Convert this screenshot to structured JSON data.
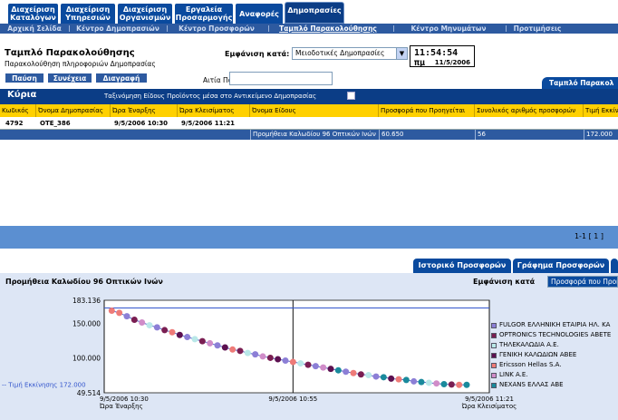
{
  "top_tabs": [
    {
      "label_1": "Διαχείριση",
      "label_2": "Καταλόγων"
    },
    {
      "label_1": "Διαχείριση",
      "label_2": "Υπηρεσιών"
    },
    {
      "label_1": "Διαχείριση",
      "label_2": "Οργανισμών"
    },
    {
      "label_1": "Εργαλεία",
      "label_2": "Προσαρμογής"
    },
    {
      "label_1": "Αναφορές",
      "label_2": ""
    },
    {
      "label_1": "Δημοπρασίες",
      "label_2": ""
    }
  ],
  "sub_tabs": [
    "Αρχική Σελίδα",
    "Κέντρο Δημοπρασιών",
    "Κέντρο Προσφορών",
    "Ταμπλό Παρακολούθησης",
    "Κέντρο Μηνυμάτων",
    "Προτιμήσεις"
  ],
  "header": {
    "title": "Ταμπλό Παρακολούθησης",
    "subtitle": "Παρακολούθηση πληροφοριών Δημοπρασίας",
    "show_label": "Εμφάνιση κατά:",
    "show_value": "Μειοδοτικές Δημοπρασίες",
    "clock_time": "11:54:54 πμ",
    "clock_date": "11/5/2006"
  },
  "buttons": {
    "pause": "Παύση",
    "continue": "Συνέχεια",
    "delete": "Διαγραφή"
  },
  "reason_label": "Αιτία Παύσης",
  "right_tab": "Ταμπλό Παρακολ",
  "main": {
    "title": "Κύρια",
    "group_label": "Ταξινόμηση Είδους Προϊόντος μέσα στο Αντικείμενο Δημοπρασίας"
  },
  "columns": [
    "Κωδικός",
    "Όνομα Δημοπρασίας",
    "Ώρα Έναρξης",
    "Ώρα Κλεισίματος",
    "Όνομα Είδους",
    "Προσφορά που Προηγείται",
    "Συνολικός αριθμός προσφορών",
    "Τιμή Εκκίνη"
  ],
  "row": {
    "code": "4792",
    "name": "OTE_386",
    "start": "9/5/2006 10:30",
    "end": "9/5/2006 11:21"
  },
  "row_item": {
    "item_name": "Προμήθεια Καλωδίου 96 Οπτικών Ινών",
    "leading_bid": "60.650",
    "total_bids": "56",
    "start_price": "172.000"
  },
  "pager": "1-1 [ 1 ]",
  "bottom_tabs": [
    "Ιστορικό Προσφορών",
    "Γράφημα Προσφορών"
  ],
  "chart_panel": {
    "title": "Προμήθεια Καλωδίου 96 Οπτικών Ινών",
    "show_label": "Εμφάνιση κατά",
    "show_value": "Προσφορά που Προηγείται"
  },
  "chart_data": {
    "type": "scatter",
    "y_ticks": [
      "183.136",
      "150.000",
      "100.000",
      "49.514"
    ],
    "ylim": [
      49.514,
      183.136
    ],
    "x_ticks": [
      {
        "time": "9/5/2006 10:30",
        "label": "Ώρα Έναρξης"
      },
      {
        "time": "9/5/2006 10:55",
        "label": ""
      },
      {
        "time": "9/5/2006 11:21",
        "label": "Ώρα Κλεισίματος"
      }
    ],
    "xlim_minutes": [
      0,
      51
    ],
    "reference_line": {
      "label": "-- Τιμή Εκκίνησης 172.000",
      "value": 172.0
    },
    "legend": [
      {
        "name": "FULGOR ΕΛΛΗΝΙΚΗ ΕΤΑΙΡΙΑ ΗΛ. ΚΑ",
        "color": "#8c7fd6"
      },
      {
        "name": "OPTRONICS TECHNOLOGIES ABETE",
        "color": "#7a1e52"
      },
      {
        "name": "ΤΗΛΕΚΑΛΩΔΙΑ Α.Ε.",
        "color": "#b9e8e8"
      },
      {
        "name": "ΓΕΝΙΚΗ ΚΑΛΩΔΙΩΝ ΑΒΕΕ",
        "color": "#5c1050"
      },
      {
        "name": "Ericsson Hellas S.A.",
        "color": "#ee7b78"
      },
      {
        "name": "LINK A.E.",
        "color": "#d08cc8"
      },
      {
        "name": "NEXANS ΕΛΛΑΣ ΑΒΕ",
        "color": "#1a8a9c"
      }
    ],
    "points": [
      [
        1,
        168,
        4
      ],
      [
        2,
        165,
        4
      ],
      [
        3,
        160,
        0
      ],
      [
        4,
        155,
        1
      ],
      [
        5,
        151,
        5
      ],
      [
        6,
        147,
        2
      ],
      [
        7,
        144,
        0
      ],
      [
        8,
        140,
        1
      ],
      [
        9,
        137,
        4
      ],
      [
        10,
        133,
        3
      ],
      [
        11,
        130,
        0
      ],
      [
        12,
        127,
        2
      ],
      [
        13,
        124,
        1
      ],
      [
        14,
        121,
        5
      ],
      [
        15,
        118,
        0
      ],
      [
        16,
        115,
        3
      ],
      [
        17,
        112,
        4
      ],
      [
        18,
        110,
        1
      ],
      [
        19,
        107,
        2
      ],
      [
        20,
        105,
        0
      ],
      [
        21,
        102,
        5
      ],
      [
        22,
        100,
        1
      ],
      [
        23,
        98,
        3
      ],
      [
        24,
        96,
        0
      ],
      [
        25,
        94,
        4
      ],
      [
        26,
        92,
        2
      ],
      [
        27,
        90,
        1
      ],
      [
        28,
        88,
        0
      ],
      [
        29,
        86,
        5
      ],
      [
        30,
        84,
        3
      ],
      [
        31,
        82,
        6
      ],
      [
        32,
        80,
        0
      ],
      [
        33,
        78,
        4
      ],
      [
        34,
        76,
        1
      ],
      [
        35,
        75,
        2
      ],
      [
        36,
        73,
        0
      ],
      [
        37,
        72,
        6
      ],
      [
        38,
        70,
        3
      ],
      [
        39,
        69,
        4
      ],
      [
        40,
        68,
        6
      ],
      [
        41,
        66,
        0
      ],
      [
        42,
        65,
        6
      ],
      [
        43,
        64,
        2
      ],
      [
        44,
        63,
        5
      ],
      [
        45,
        62,
        6
      ],
      [
        46,
        61.5,
        1
      ],
      [
        47,
        61,
        4
      ],
      [
        48,
        61,
        6
      ]
    ]
  }
}
